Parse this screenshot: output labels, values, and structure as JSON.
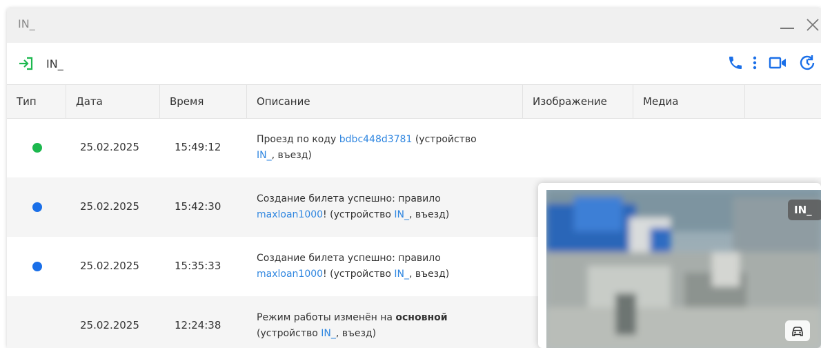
{
  "window": {
    "title": "IN_"
  },
  "toolbar": {
    "device_name": "IN_"
  },
  "table": {
    "columns": [
      "Тип",
      "Дата",
      "Время",
      "Описание",
      "Изображение",
      "Медиа"
    ],
    "rows": [
      {
        "type_color": "#1cb84e",
        "date": "25.02.2025",
        "time": "15:49:12",
        "desc": {
          "t1": "Проезд по коду ",
          "l1": "bdbc448d3781",
          "t2": " (устройство ",
          "l2": "IN_",
          "t3": ", въезд)"
        }
      },
      {
        "type_color": "#1a6fe8",
        "date": "25.02.2025",
        "time": "15:42:30",
        "desc": {
          "t1": "Создание билета успешно: правило ",
          "l1": "maxloan1000",
          "t2": "! (устройство ",
          "l2": "IN_",
          "t3": ", въезд)"
        }
      },
      {
        "type_color": "#1a6fe8",
        "date": "25.02.2025",
        "time": "15:35:33",
        "desc": {
          "t1": "Создание билета успешно: правило ",
          "l1": "maxloan1000",
          "t2": "! (устройство ",
          "l2": "IN_",
          "t3": ", въезд)"
        }
      },
      {
        "type_color": "",
        "date": "25.02.2025",
        "time": "12:24:38",
        "desc": {
          "t1": "Режим работы изменён на ",
          "b1": "основной",
          "t2": "(устройство ",
          "l2": "IN_",
          "t3": ", въезд)"
        }
      }
    ]
  },
  "preview": {
    "badge": "IN_"
  },
  "colors": {
    "accent": "#1a6fe8",
    "link": "#2f86e0",
    "enter_icon": "#1cb84e"
  }
}
